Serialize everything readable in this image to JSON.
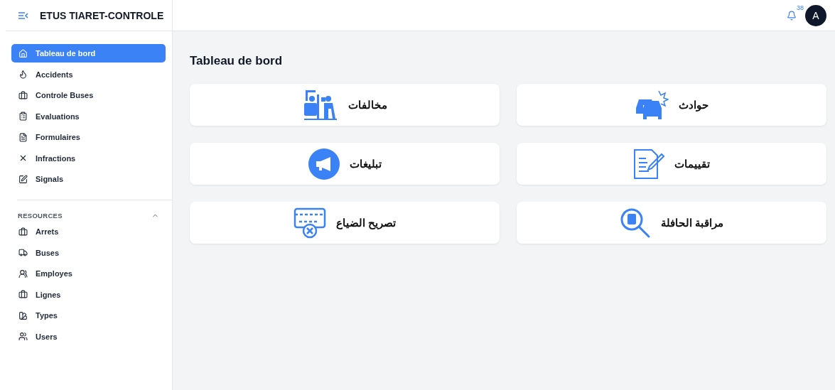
{
  "app": {
    "title": "ETUS TIARET-CONTROLE"
  },
  "sidebar": {
    "items": [
      {
        "label": "Tableau de bord",
        "selected": true
      },
      {
        "label": "Accidents",
        "selected": false
      },
      {
        "label": "Controle Buses",
        "selected": false
      },
      {
        "label": "Evaluations",
        "selected": false
      },
      {
        "label": "Formulaires",
        "selected": false
      },
      {
        "label": "Infractions",
        "selected": false
      },
      {
        "label": "Signals",
        "selected": false
      }
    ],
    "section": {
      "title": "RESOURCES",
      "expanded": true,
      "items": [
        {
          "label": "Arrets",
          "selected": false
        },
        {
          "label": "Buses",
          "selected": false
        },
        {
          "label": "Employes",
          "selected": false
        },
        {
          "label": "Lignes",
          "selected": false
        },
        {
          "label": "Types",
          "selected": false
        },
        {
          "label": "Users",
          "selected": false
        }
      ]
    }
  },
  "header": {
    "notifications": "38",
    "avatar": "A"
  },
  "page": {
    "title": "Tableau de bord"
  },
  "cards": [
    {
      "label": "مخالفات",
      "kind": "violation"
    },
    {
      "label": "حوادث",
      "kind": "accident"
    },
    {
      "label": "تبليغات",
      "kind": "announcement"
    },
    {
      "label": "تقييمات",
      "kind": "evaluation"
    },
    {
      "label": "تصريح الضياع",
      "kind": "lost"
    },
    {
      "label": "مراقبة الحافلة",
      "kind": "bus-search"
    }
  ]
}
